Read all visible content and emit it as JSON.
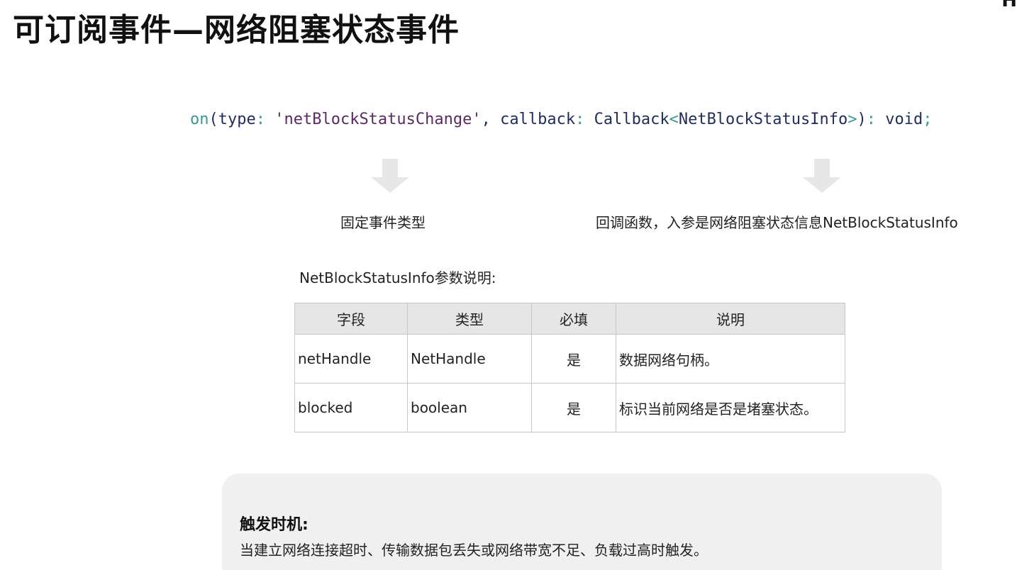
{
  "title": "可订阅事件—网络阻塞状态事件",
  "corner_text": "H",
  "code": {
    "method": "on",
    "open_paren": "(",
    "param1_name": "type",
    "colon1": ": ",
    "param1_value": "'netBlockStatusChange'",
    "comma": ", ",
    "param2_name": "callback",
    "colon2": ": ",
    "param2_type": "Callback",
    "angle_open": "<",
    "generic_type": "NetBlockStatusInfo",
    "angle_close": ">",
    "close_paren": ")",
    "colon3": ": ",
    "return_type": "void",
    "semicolon": ";"
  },
  "captions": {
    "event_type": "固定事件类型",
    "callback_desc": "回调函数，入参是网络阻塞状态信息NetBlockStatusInfo"
  },
  "table": {
    "title": "NetBlockStatusInfo参数说明:",
    "headers": [
      "字段",
      "类型",
      "必填",
      "说明"
    ],
    "rows": [
      [
        "netHandle",
        "NetHandle",
        "是",
        "数据网络句柄。"
      ],
      [
        "blocked",
        "boolean",
        "是",
        "标识当前网络是否是堵塞状态。"
      ]
    ]
  },
  "note": {
    "heading": "触发时机:",
    "body": "当建立网络连接超时、传输数据包丢失或网络带宽不足、负载过高时触发。"
  },
  "icons": {
    "arrow": "down-arrow-icon"
  }
}
